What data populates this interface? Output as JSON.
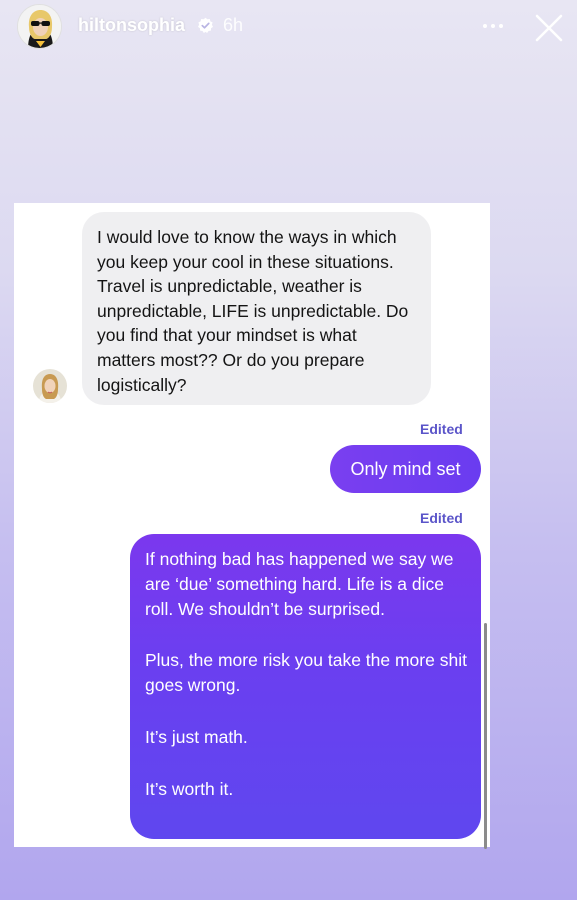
{
  "header": {
    "username": "hiltonsophia",
    "time": "6h",
    "verified": true,
    "icons": {
      "more": "more-options-icon",
      "close": "close-icon",
      "verified": "verified-badge-icon"
    }
  },
  "conversation": {
    "incoming_message": "I would love to know the ways in which you keep your cool in these situations. Travel is unpredictable, weather is unpredictable, LIFE is unpredictable. Do you find that your mindset is what matters most?? Or do you prepare logistically?",
    "reply_1": {
      "edited_label": "Edited",
      "text": "Only mind set"
    },
    "reply_2": {
      "edited_label": "Edited",
      "paragraphs": [
        "If nothing bad has happened we say we are ‘due’ something hard. Life is a dice roll. We shouldn’t  be surprised.",
        "Plus, the more risk you take the more shit goes wrong.",
        "It’s just math.",
        "It’s worth it."
      ]
    }
  },
  "colors": {
    "outgoing_bubble": "#6a3cf0",
    "incoming_bubble": "#efeff1",
    "edited_label": "#5b55c9",
    "background_top": "#e8e6f3",
    "background_bottom": "#b1a6ee"
  }
}
